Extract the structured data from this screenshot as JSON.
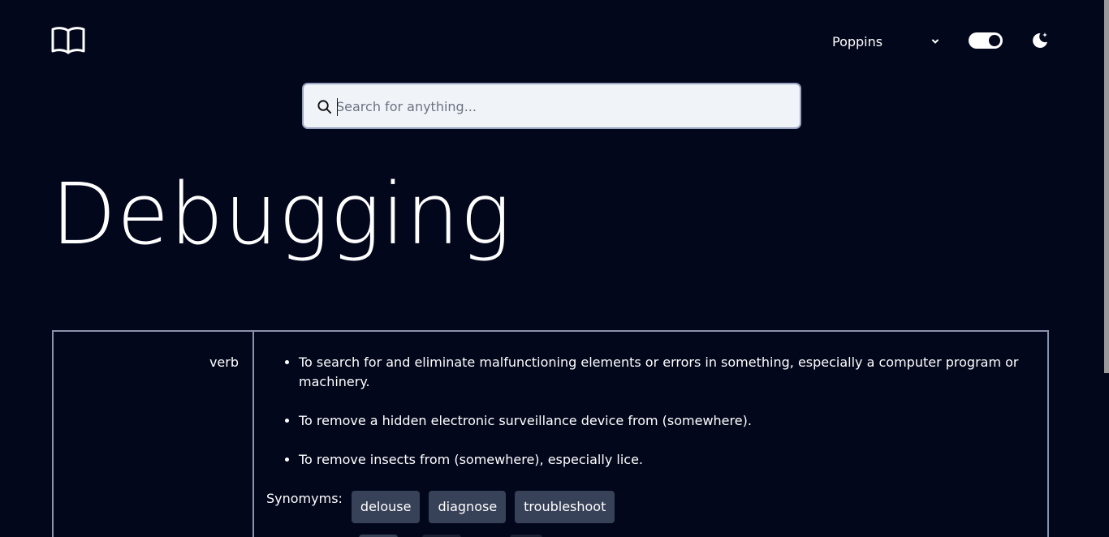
{
  "header": {
    "logo_icon": "book-open-icon",
    "font_selector": {
      "selected": "Poppins",
      "icon": "chevron-down-icon"
    },
    "theme_toggle": {
      "state": "on"
    },
    "theme_icon": "moon-sparkle-icon"
  },
  "search": {
    "placeholder": "Search for anything...",
    "value": "",
    "icon": "search-icon"
  },
  "entry": {
    "word": "Debugging",
    "part_of_speech": "verb",
    "meanings": [
      "To search for and eliminate malfunctioning elements or errors in something, especially a computer program or machinery.",
      "To remove a hidden electronic surveillance device from (somewhere).",
      "To remove insects from (somewhere), especially lice."
    ],
    "synonyms_label": "Synomyms:",
    "synonyms": [
      "delouse",
      "diagnose",
      "troubleshoot"
    ]
  },
  "colors": {
    "background": "#03071c",
    "chip": "#374157",
    "border": "#8a93ad",
    "search_bg": "#f0f4f9"
  }
}
